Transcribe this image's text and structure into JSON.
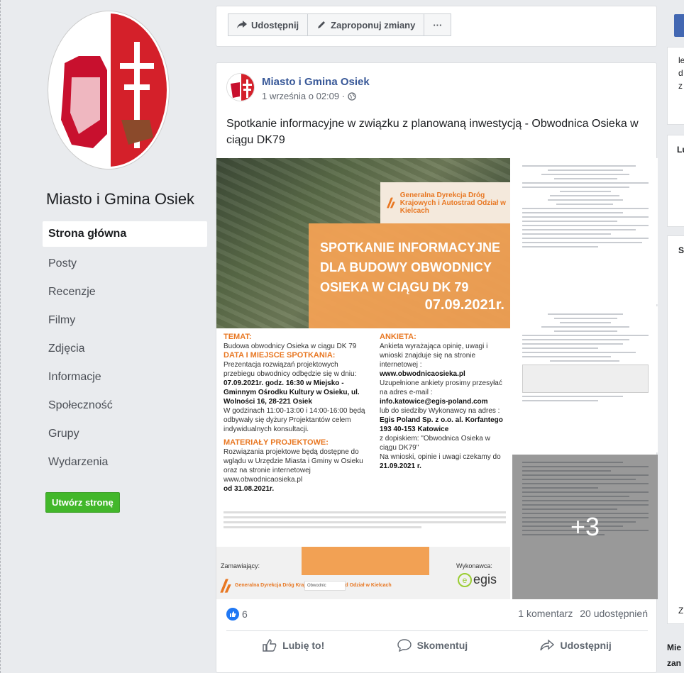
{
  "page": {
    "name": "Miasto i Gmina Osiek",
    "create_page_label": "Utwórz stronę"
  },
  "nav": [
    {
      "label": "Strona główna",
      "active": true
    },
    {
      "label": "Posty"
    },
    {
      "label": "Recenzje"
    },
    {
      "label": "Filmy"
    },
    {
      "label": "Zdjęcia"
    },
    {
      "label": "Informacje"
    },
    {
      "label": "Społeczność"
    },
    {
      "label": "Grupy"
    },
    {
      "label": "Wydarzenia"
    }
  ],
  "action_bar": {
    "share": "Udostępnij",
    "suggest": "Zaproponuj zmiany",
    "more": "···"
  },
  "post": {
    "author": "Miasto i Gmina Osiek",
    "date": "1 września o 02:09 ·",
    "text": "Spotkanie informacyjne w związku z planowaną inwestycją - Obwodnica Osieka w ciągu DK79",
    "poster": {
      "gddka": "Generalna Dyrekcja Dróg Krajowych i Autostrad Odział w Kielcach",
      "title": "SPOTKANIE INFORMACYJNE DLA BUDOWY OBWODNICY OSIEKA W CIĄGU DK 79",
      "date": "07.09.2021r.",
      "temat_h": "TEMAT:",
      "temat": "Budowa obwodnicy Osieka w ciągu DK 79",
      "data_h": "DATA I MIEJSCE SPOTKANIA:",
      "data_1": "Prezentacja rozwiązań projektowych przebiegu obwodnicy odbędzie się w dniu:",
      "data_2": "07.09.2021r. godz. 16:30 w Miejsko - Gminnym Ośrodku Kultury w Osieku, ul. Wolności 16, 28-221 Osiek",
      "data_3": "W godzinach 11:00-13:00 i 14:00-16:00 będą odbywały się dyżury Projektantów celem indywidualnych konsultacji.",
      "mat_h": "MATERIAŁY PROJEKTOWE:",
      "mat_1": "Rozwiązania projektowe będą dostępne do wglądu w Urzędzie Miasta i Gminy w Osieku oraz na stronie internetowej www.obwodnicaosieka.pl",
      "mat_2": "od 31.08.2021r.",
      "ank_h": "ANKIETA:",
      "ank_1": "Ankieta wyrażająca opinię, uwagi i wnioski znajduje się na stronie internetowej :",
      "ank_2": "www.obwodnicaosieka.pl",
      "ank_3": "Uzupełnione ankiety prosimy przesyłać na adres e-mail :",
      "ank_4": "info.katowice@egis-poland.com",
      "ank_5": "lub do siedziby Wykonawcy na adres :",
      "ank_6": "Egis Poland Sp. z o.o. al. Korfantego 193 40-153 Katowice",
      "ank_7": "z dopiskiem: \"Obwodnica Osieka w ciągu DK79\"",
      "ank_8": "Na wnioski, opinie i uwagi czekamy do",
      "ank_9": "21.09.2021 r.",
      "zamawiajacy": "Zamawiający:",
      "wykonawca": "Wykonawca:",
      "egis": "egis",
      "o100": "Obwodnic"
    },
    "more_photos": "+3",
    "like_count": "6",
    "comments": "1 komentarz",
    "shares": "20 udostępnień",
    "like_btn": "Lubię to!",
    "comment_btn": "Skomentuj",
    "share_btn": "Udostępnij"
  },
  "right_column": {
    "frag_1": "le",
    "frag_2": "d",
    "frag_3": "z",
    "frag_4": "Lu",
    "frag_5": "S",
    "frag_6": "Z",
    "frag_7": "Mie",
    "frag_8": "zan"
  },
  "colors": {
    "fb_blue": "#4267b2",
    "link": "#385898",
    "green": "#42b72a",
    "orange": "#f2a154"
  }
}
